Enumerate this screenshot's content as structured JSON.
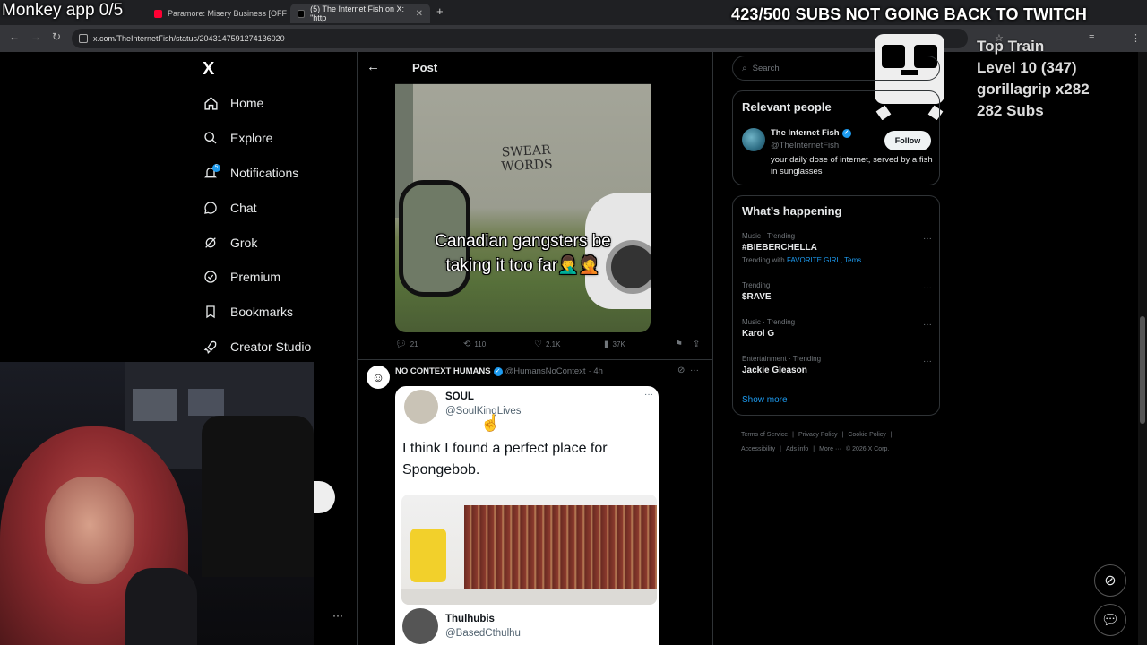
{
  "overlay": {
    "title": "Monkey app 0/5",
    "banner": "423/500 SUBS NOT GOING BACK TO TWITCH",
    "train": {
      "title": "Top Train",
      "level": "Level 10  (347)",
      "user": "gorillagrip x282",
      "subs": "282 Subs"
    }
  },
  "browser": {
    "tabs": [
      {
        "label": "Paramore: Misery Business [OFF",
        "favicon_color": "#ff0033"
      },
      {
        "label": "(5) The Internet Fish on X: \"http",
        "favicon_color": "#000000"
      }
    ],
    "url": "x.com/TheInternetFish/status/2043147591274136020"
  },
  "sidebar": {
    "logo": "X",
    "notif_count": "5",
    "items": [
      {
        "label": "Home",
        "icon": "home-icon"
      },
      {
        "label": "Explore",
        "icon": "search-icon"
      },
      {
        "label": "Notifications",
        "icon": "bell-icon"
      },
      {
        "label": "Chat",
        "icon": "chat-icon"
      },
      {
        "label": "Grok",
        "icon": "grok-icon"
      },
      {
        "label": "Premium",
        "icon": "verified-icon"
      },
      {
        "label": "Bookmarks",
        "icon": "bookmark-icon"
      },
      {
        "label": "Creator Studio",
        "icon": "rocket-icon"
      }
    ]
  },
  "post": {
    "header": "Post",
    "media_caption_line1": "Canadian gangsters be",
    "media_caption_line2": "taking it too far🤦‍♂️🤦",
    "graffiti_line1": "SWEAR",
    "graffiti_line2": "WORDS",
    "stats": {
      "replies": "21",
      "reposts": "110",
      "likes": "2.1K",
      "views": "37K"
    }
  },
  "tweet2": {
    "name": "NO CONTEXT HUMANS",
    "handle": "@HumansNoContext",
    "time": "· 4h",
    "embedded": {
      "name": "SOUL",
      "handle": "@SoulKingLives",
      "text": "I think I found a perfect place for Spongebob.",
      "reply_name": "Thulhubis",
      "reply_handle": "@BasedCthulhu"
    }
  },
  "right": {
    "search_placeholder": "Search",
    "relevant_title": "Relevant people",
    "person": {
      "name": "The Internet Fish",
      "handle": "@TheInternetFish",
      "bio": "your daily dose of internet, served by a fish in sunglasses",
      "follow": "Follow"
    },
    "happening_title": "What’s happening",
    "trends": [
      {
        "category": "Music · Trending",
        "name": "#BIEBERCHELLA",
        "with_prefix": "Trending with",
        "with_links": "FAVORITE GIRL, Tems"
      },
      {
        "category": "Trending",
        "name": "$RAVE"
      },
      {
        "category": "Music · Trending",
        "name": "Karol G"
      },
      {
        "category": "Entertainment · Trending",
        "name": "Jackie Gleason"
      }
    ],
    "show_more": "Show more",
    "footer": [
      "Terms of Service",
      "|",
      "Privacy Policy",
      "|",
      "Cookie Policy",
      "|",
      "Accessibility",
      "|",
      "Ads info",
      "|",
      "More ···",
      "© 2026 X Corp."
    ]
  }
}
